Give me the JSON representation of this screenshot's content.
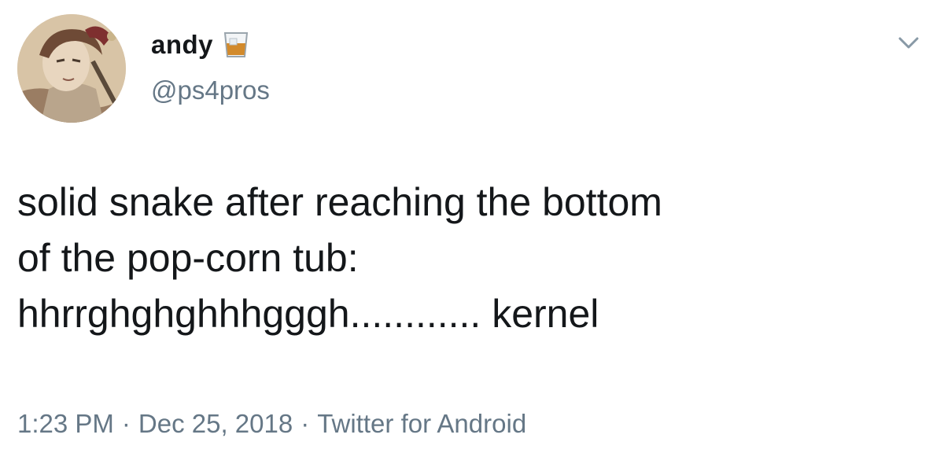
{
  "user": {
    "display_name": "andy",
    "handle": "@ps4pros",
    "name_emoji": "drink-icon"
  },
  "tweet": {
    "lines": [
      "solid snake after reaching the bottom",
      "of the pop-corn tub:",
      "hhrrghghghhhgggh............ kernel"
    ]
  },
  "meta": {
    "time": "1:23 PM",
    "date": "Dec 25, 2018",
    "source": "Twitter for Android",
    "separator": "·"
  },
  "colors": {
    "text": "#14171a",
    "secondary": "#657786"
  }
}
